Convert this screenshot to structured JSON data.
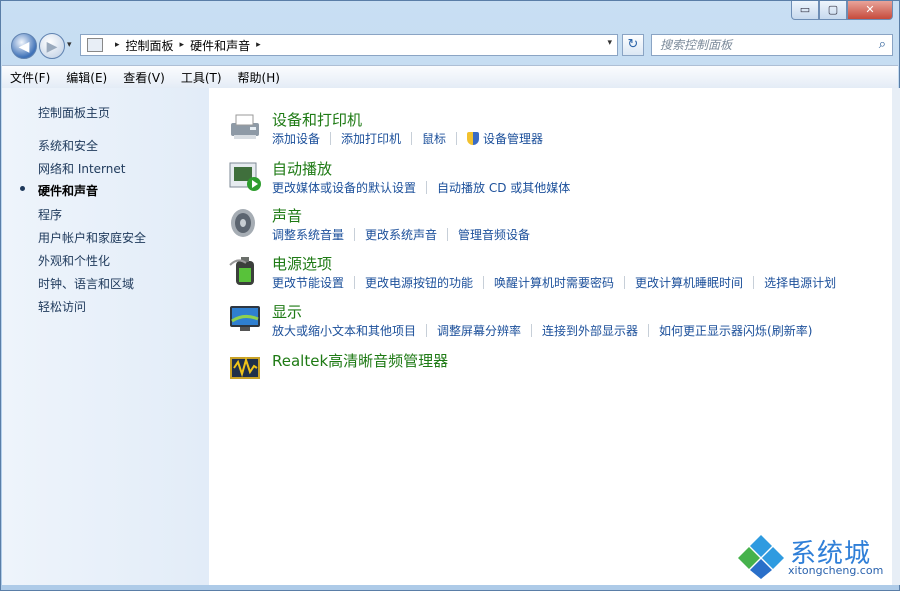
{
  "window": {
    "minimize": "▭",
    "maximize": "▢",
    "close": "✕"
  },
  "nav": {
    "back_icon": "◀",
    "forward_icon": "▶",
    "dropdown_icon": "▾",
    "refresh_icon": "↻"
  },
  "address": {
    "crumbs": [
      "控制面板",
      "硬件和声音"
    ],
    "sep": "▸"
  },
  "search": {
    "placeholder": "搜索控制面板",
    "icon": "⌕"
  },
  "menu": [
    "文件(F)",
    "编辑(E)",
    "查看(V)",
    "工具(T)",
    "帮助(H)"
  ],
  "sidebar": {
    "home": "控制面板主页",
    "items": [
      "系统和安全",
      "网络和 Internet",
      "硬件和声音",
      "程序",
      "用户帐户和家庭安全",
      "外观和个性化",
      "时钟、语言和区域",
      "轻松访问"
    ],
    "current_index": 2
  },
  "categories": [
    {
      "title": "设备和打印机",
      "icon": "printer-icon",
      "links": [
        "添加设备",
        "添加打印机",
        "鼠标",
        "设备管理器"
      ]
    },
    {
      "title": "自动播放",
      "icon": "autoplay-icon",
      "links": [
        "更改媒体或设备的默认设置",
        "自动播放 CD 或其他媒体"
      ]
    },
    {
      "title": "声音",
      "icon": "speaker-icon",
      "links": [
        "调整系统音量",
        "更改系统声音",
        "管理音频设备"
      ]
    },
    {
      "title": "电源选项",
      "icon": "battery-icon",
      "links": [
        "更改节能设置",
        "更改电源按钮的功能",
        "唤醒计算机时需要密码",
        "更改计算机睡眠时间",
        "选择电源计划"
      ]
    },
    {
      "title": "显示",
      "icon": "monitor-icon",
      "links": [
        "放大或缩小文本和其他项目",
        "调整屏幕分辨率",
        "连接到外部显示器",
        "如何更正显示器闪烁(刷新率)"
      ]
    },
    {
      "title": "Realtek高清晰音频管理器",
      "icon": "realtek-icon",
      "links": []
    }
  ],
  "watermark": {
    "text": "系统城",
    "url": "xitongcheng.com"
  }
}
